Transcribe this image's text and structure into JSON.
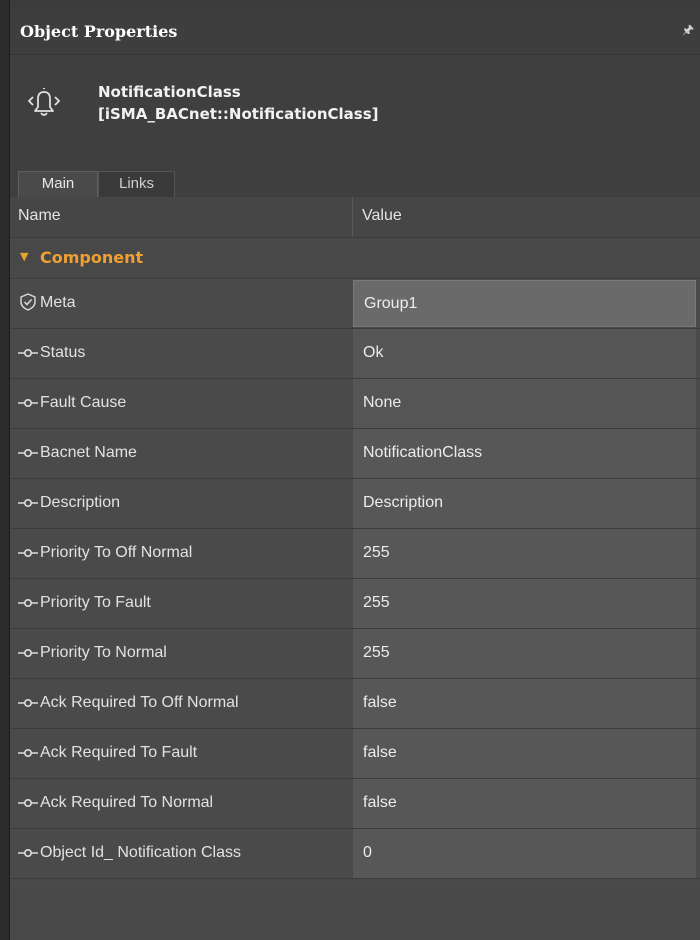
{
  "panel": {
    "title": "Object Properties",
    "pin_icon": "pin-icon"
  },
  "object": {
    "name": "NotificationClass",
    "type": "[iSMA_BACnet::NotificationClass]",
    "icon": "bell-notification-icon"
  },
  "tabs": [
    {
      "label": "Main",
      "active": true
    },
    {
      "label": "Links",
      "active": false
    }
  ],
  "columns": {
    "name": "Name",
    "value": "Value"
  },
  "category": {
    "label": "Component",
    "icon": "triangle-down-icon"
  },
  "rows": [
    {
      "name": "Meta",
      "value": "Group1",
      "icon": "shield-check-icon"
    },
    {
      "name": "Status",
      "value": "Ok",
      "icon": "slot-icon"
    },
    {
      "name": "Fault Cause",
      "value": "None",
      "icon": "slot-icon"
    },
    {
      "name": "Bacnet Name",
      "value": "NotificationClass",
      "icon": "slot-icon"
    },
    {
      "name": "Description",
      "value": "Description",
      "icon": "slot-icon"
    },
    {
      "name": "Priority To Off Normal",
      "value": "255",
      "icon": "slot-icon"
    },
    {
      "name": "Priority To Fault",
      "value": "255",
      "icon": "slot-icon"
    },
    {
      "name": "Priority To Normal",
      "value": "255",
      "icon": "slot-icon"
    },
    {
      "name": "Ack Required To Off Normal",
      "value": "false",
      "icon": "slot-icon"
    },
    {
      "name": "Ack Required To Fault",
      "value": "false",
      "icon": "slot-icon"
    },
    {
      "name": "Ack Required To Normal",
      "value": "false",
      "icon": "slot-icon"
    },
    {
      "name": "Object Id_ Notification Class",
      "value": "0",
      "icon": "slot-icon"
    }
  ],
  "colors": {
    "accent": "#f0a030",
    "background": "#4a4a4a"
  }
}
